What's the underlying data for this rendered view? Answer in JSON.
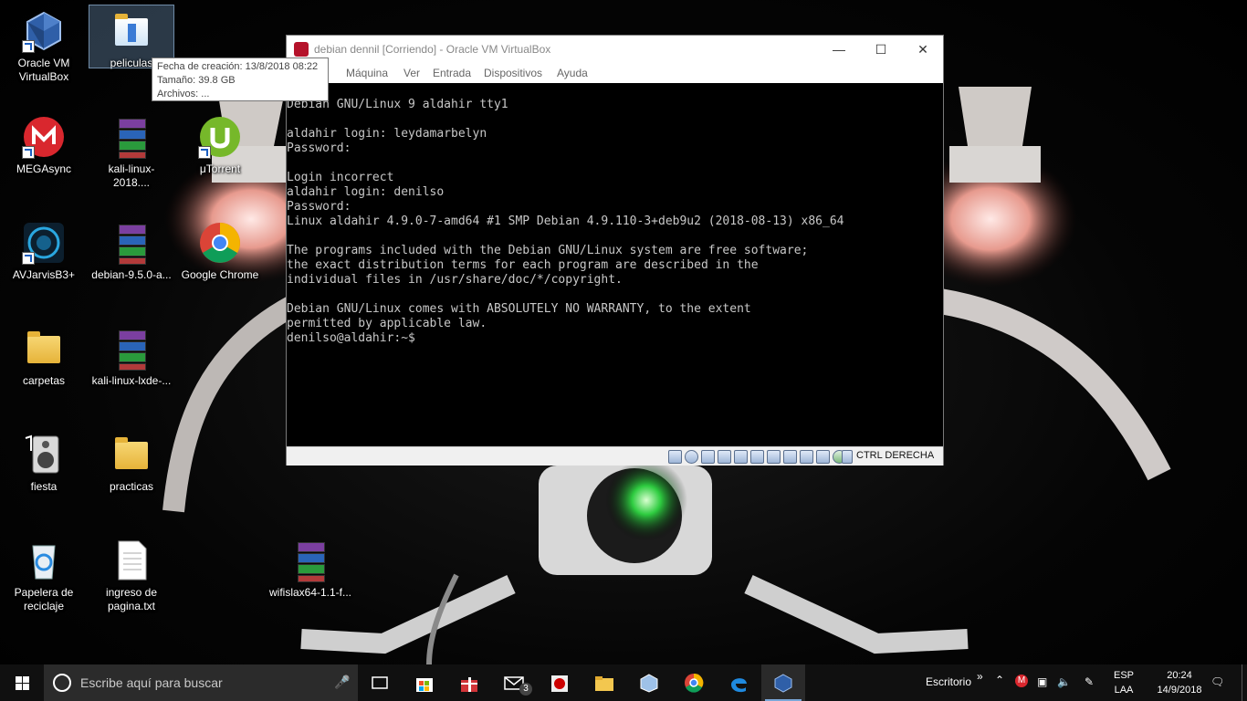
{
  "desktop": {
    "icons": [
      {
        "label": "Oracle VM\nVirtualBox",
        "icon": "virtualbox-icon"
      },
      {
        "label": "peliculas",
        "icon": "folder-icon"
      },
      {
        "label": "MEGAsync",
        "icon": "mega-icon"
      },
      {
        "label": "kali-linux-2018....",
        "icon": "winrar-archive-icon"
      },
      {
        "label": "μTorrent",
        "icon": "utorrent-icon"
      },
      {
        "label": "AVJarvisB3+",
        "icon": "jarvis-icon"
      },
      {
        "label": "debian-9.5.0-a...",
        "icon": "winrar-archive-icon"
      },
      {
        "label": "Google Chrome",
        "icon": "chrome-icon"
      },
      {
        "label": "carpetas",
        "icon": "folder-icon"
      },
      {
        "label": "kali-linux-lxde-...",
        "icon": "winrar-archive-icon"
      },
      {
        "label": "fiesta",
        "icon": "speaker-icon"
      },
      {
        "label": "practicas",
        "icon": "folder-icon"
      },
      {
        "label": "Papelera de\nreciclaje",
        "icon": "recycle-bin-icon"
      },
      {
        "label": "ingreso de\npagina.txt",
        "icon": "text-file-icon"
      },
      {
        "label": "wifislax64-1.1-f...",
        "icon": "winrar-archive-icon"
      }
    ]
  },
  "tooltip": {
    "line1": "Fecha de creación: 13/8/2018 08:22",
    "line2": "Tamaño: 39.8 GB",
    "line3": "Archivos: ..."
  },
  "vbox": {
    "title": "debian dennil [Corriendo] - Oracle VM VirtualBox",
    "menu": [
      "Máquina",
      "Ver",
      "Entrada",
      "Dispositivos",
      "Ayuda"
    ],
    "terminal": "Debian GNU/Linux 9 aldahir tty1\n\naldahir login: leydamarbelyn\nPassword:\n\nLogin incorrect\naldahir login: denilso\nPassword:\nLinux aldahir 4.9.0-7-amd64 #1 SMP Debian 4.9.110-3+deb9u2 (2018-08-13) x86_64\n\nThe programs included with the Debian GNU/Linux system are free software;\nthe exact distribution terms for each program are described in the\nindividual files in /usr/share/doc/*/copyright.\n\nDebian GNU/Linux comes with ABSOLUTELY NO WARRANTY, to the extent\npermitted by applicable law.\ndenilso@aldahir:~$",
    "host_key": "CTRL DERECHA"
  },
  "taskbar": {
    "search_placeholder": "Escribe aquí para buscar",
    "mail_badge": "3",
    "desktop_label": "Escritorio",
    "lang_top": "ESP",
    "lang_bottom": "LAA",
    "time": "20:24",
    "date": "14/9/2018"
  },
  "colors": {
    "taskbar": "#101010",
    "search_bg": "#2b2b2b",
    "terminal_text": "#c8c8c8",
    "selection": "#7aa0c8"
  }
}
